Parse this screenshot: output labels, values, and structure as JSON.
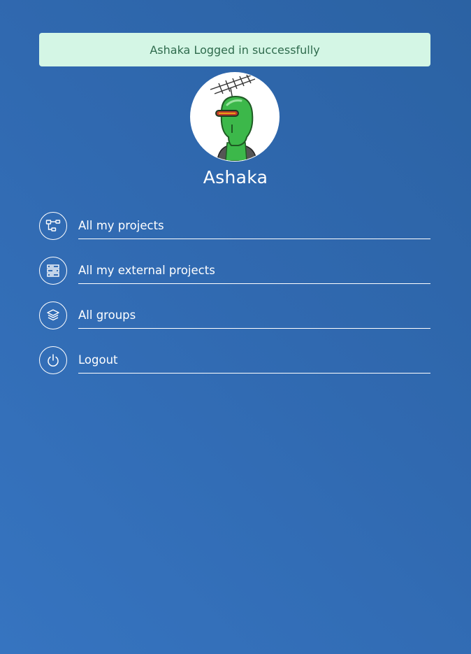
{
  "toast": {
    "message": "Ashaka Logged in successfully",
    "background": "#d4f6e5",
    "text_color": "#2f6b4d"
  },
  "profile": {
    "username": "Ashaka",
    "avatar_icon": "robot-avatar-icon"
  },
  "menu": {
    "items": [
      {
        "label": "All my projects",
        "icon": "hierarchy-icon"
      },
      {
        "label": "All my external projects",
        "icon": "server-icon"
      },
      {
        "label": "All groups",
        "icon": "layers-icon"
      },
      {
        "label": "Logout",
        "icon": "power-icon"
      }
    ]
  },
  "colors": {
    "background": "#3069b0",
    "foreground": "#ffffff"
  }
}
